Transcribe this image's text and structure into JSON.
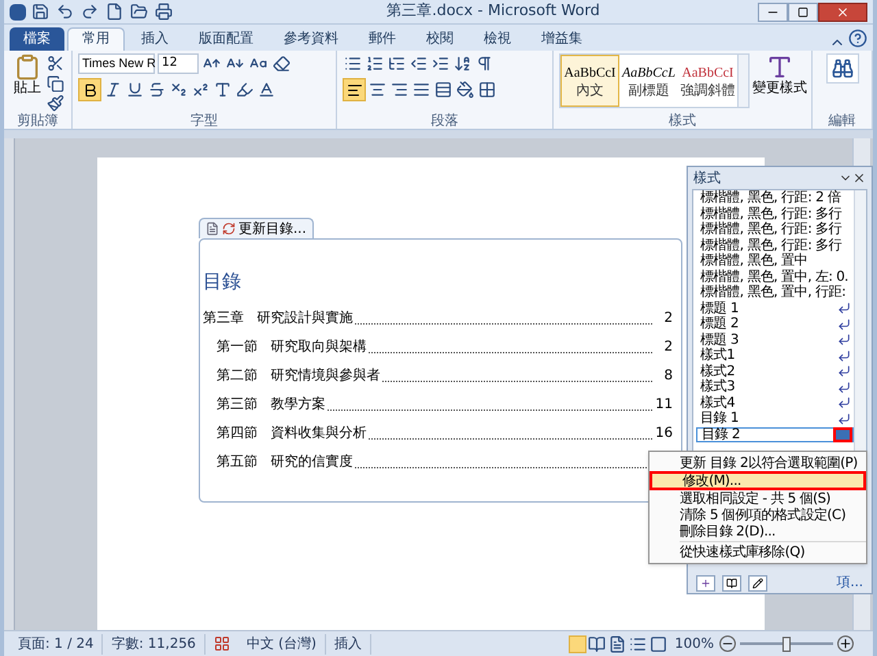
{
  "window": {
    "title": "第三章.docx - Microsoft Word"
  },
  "tabs": [
    {
      "label": "檔案",
      "kind": "file",
      "selected": false
    },
    {
      "label": "常用",
      "kind": "tab",
      "selected": true
    },
    {
      "label": "插入",
      "kind": "tab",
      "selected": false
    },
    {
      "label": "版面配置",
      "kind": "tab",
      "selected": false
    },
    {
      "label": "參考資料",
      "kind": "tab",
      "selected": false
    },
    {
      "label": "郵件",
      "kind": "tab",
      "selected": false
    },
    {
      "label": "校閱",
      "kind": "tab",
      "selected": false
    },
    {
      "label": "檢視",
      "kind": "tab",
      "selected": false
    },
    {
      "label": "增益集",
      "kind": "tab",
      "selected": false
    }
  ],
  "ribbon": {
    "clipboard": {
      "paste": "貼上",
      "label": "剪貼簿"
    },
    "font": {
      "font_name": "Times New R",
      "font_size": "12",
      "label": "字型"
    },
    "paragraph": {
      "label": "段落"
    },
    "styles": {
      "gallery": [
        {
          "preview": "AaBbCcI",
          "name": "內文",
          "kind": "normal",
          "selected": true
        },
        {
          "preview": "AaBbCcL",
          "name": "副標題",
          "kind": "italic",
          "selected": false
        },
        {
          "preview": "AaBbCcI",
          "name": "強調斜體",
          "kind": "emphasis",
          "selected": false
        }
      ],
      "change_styles": "變更樣式",
      "label": "樣式"
    },
    "editing": {
      "label": "編輯"
    }
  },
  "document": {
    "toc_update": "更新目錄...",
    "heading": "目錄",
    "entries": [
      {
        "number": "第三章",
        "title": "研究設計與實施",
        "page": "2",
        "children": [
          {
            "number": "第一節",
            "title": "研究取向與架構",
            "page": "2"
          },
          {
            "number": "第二節",
            "title": "研究情境與參與者",
            "page": "8"
          },
          {
            "number": "第三節",
            "title": "教學方案",
            "page": "11"
          },
          {
            "number": "第四節",
            "title": "資料收集與分析",
            "page": "16"
          },
          {
            "number": "第五節",
            "title": "研究的信實度"
          }
        ]
      }
    ]
  },
  "styles_pane": {
    "title": "樣式",
    "items": [
      {
        "label": "標楷體, 黑色, 行距: 2 倍",
        "kind": "character",
        "selected": false
      },
      {
        "label": "標楷體, 黑色, 行距: 多行",
        "kind": "character",
        "selected": false
      },
      {
        "label": "標楷體, 黑色, 行距: 多行",
        "kind": "character",
        "selected": false
      },
      {
        "label": "標楷體, 黑色, 行距: 多行",
        "kind": "character",
        "selected": false
      },
      {
        "label": "標楷體, 黑色, 置中",
        "kind": "character",
        "selected": false
      },
      {
        "label": "標楷體, 黑色, 置中, 左: 0.",
        "kind": "character",
        "selected": false
      },
      {
        "label": "標楷體, 黑色, 置中, 行距:",
        "kind": "character",
        "selected": false
      },
      {
        "label": "標題 1",
        "kind": "paragraph",
        "selected": false
      },
      {
        "label": "標題 2",
        "kind": "paragraph",
        "selected": false
      },
      {
        "label": "標題 3",
        "kind": "paragraph",
        "selected": false
      },
      {
        "label": "樣式1",
        "kind": "paragraph",
        "selected": false
      },
      {
        "label": "樣式2",
        "kind": "paragraph",
        "selected": false
      },
      {
        "label": "樣式3",
        "kind": "paragraph",
        "selected": false
      },
      {
        "label": "樣式4",
        "kind": "paragraph",
        "selected": false
      },
      {
        "label": "目錄 1",
        "kind": "paragraph",
        "selected": false
      },
      {
        "label": "目錄 2",
        "kind": "paragraph",
        "selected": true,
        "annotated": true
      }
    ],
    "options_link": "項..."
  },
  "context_menu": [
    {
      "label": "更新 目錄 2以符合選取範圍(P)",
      "selected": false,
      "annotated": false,
      "separator_before": false
    },
    {
      "label": "修改(M)...",
      "selected": true,
      "annotated": true,
      "separator_before": false
    },
    {
      "label": "選取相同設定 - 共 5 個(S)",
      "selected": false,
      "annotated": false,
      "separator_before": false
    },
    {
      "label": "清除 5 個例項的格式設定(C)",
      "selected": false,
      "annotated": false,
      "separator_before": false
    },
    {
      "label": "刪除目錄 2(D)...",
      "selected": false,
      "annotated": false,
      "separator_before": false
    },
    {
      "label": "從快速樣式庫移除(Q)",
      "selected": false,
      "annotated": false,
      "separator_before": true
    }
  ],
  "status_bar": {
    "page": "頁面: 1 / 24",
    "words": "字數: 11,256",
    "language": "中文 (台灣)",
    "mode": "插入",
    "zoom": "100%",
    "zoom_level": {
      "level": 0.5
    }
  }
}
